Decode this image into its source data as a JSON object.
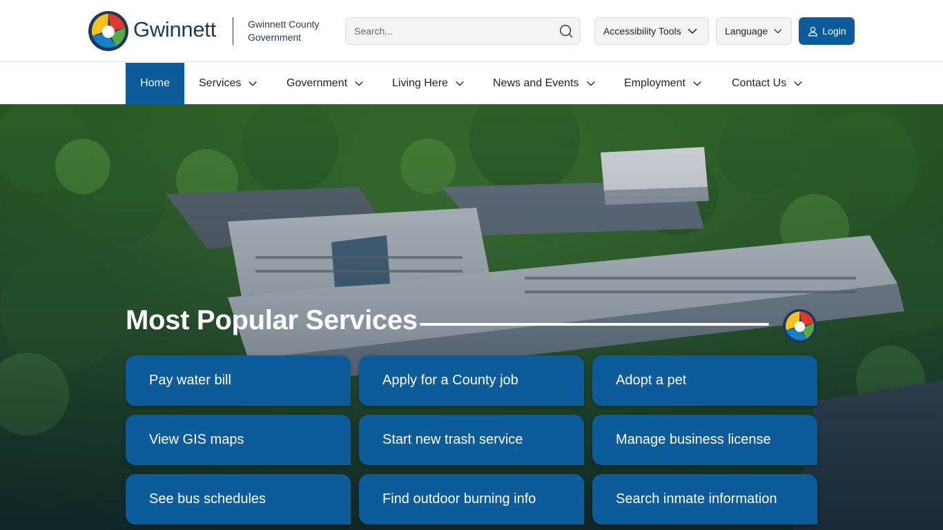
{
  "brand": {
    "wordmark": "Gwinnett",
    "sub_line1": "Gwinnett County",
    "sub_line2": "Government",
    "colors": {
      "navy": "#1d3a5a",
      "red": "#e03a2e",
      "yellow": "#f5c31c",
      "green": "#56a849",
      "blue": "#1a7fc1"
    }
  },
  "search": {
    "placeholder": "Search...",
    "value": "",
    "icon": "search-icon"
  },
  "header_buttons": {
    "accessibility": "Accessibility Tools",
    "language": "Language",
    "login": "Login"
  },
  "nav": {
    "items": [
      {
        "label": "Home",
        "active": true
      },
      {
        "label": "Services",
        "active": false
      },
      {
        "label": "Government",
        "active": false
      },
      {
        "label": "Living Here",
        "active": false
      },
      {
        "label": "News and Events",
        "active": false
      },
      {
        "label": "Employment",
        "active": false
      },
      {
        "label": "Contact Us",
        "active": false
      }
    ]
  },
  "hero": {
    "title": "Most Popular Services",
    "services": [
      "Pay water bill",
      "Apply for a County job",
      "Adopt a pet",
      "View GIS maps",
      "Start new trash service",
      "Manage business license",
      "See bus schedules",
      "Find outdoor burning info",
      "Search inmate information"
    ]
  },
  "accent_color": "#0c5b9b"
}
